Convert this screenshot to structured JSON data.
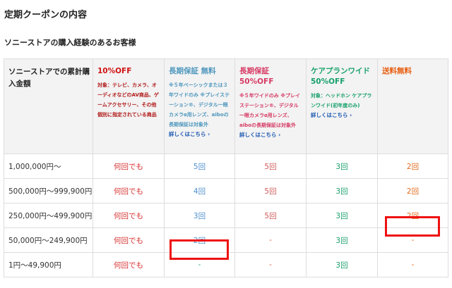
{
  "page": {
    "title": "定期クーポンの内容",
    "subtitle": "ソニーストアの購入経験のあるお客様"
  },
  "table": {
    "header_first": "ソニーストアでの累計購入金額",
    "columns": [
      {
        "title": "10%OFF",
        "note": "対象：テレビ、カメラ、オーディオなどのAV商品、ゲームアクセサリー、その他個別に指定されている商品",
        "link": ""
      },
      {
        "title": "長期保証 無料",
        "note": "※５年ベーシックまたは３年ワイドのみ ※プレイステーション®、デジタル一眼カメラα用レンズ、aiboの長期保証は対象外",
        "link": "詳しくはこちら ›"
      },
      {
        "title": "長期保証 50%OFF",
        "note": "※５年ワイドのみ ※プレイステーション®、デジタル一眼カメラα用レンズ、aiboの長期保証は対象外",
        "link": "詳しくはこちら ›"
      },
      {
        "title": "ケアプランワイド 50%OFF",
        "note": "対象：ヘッドホン ケアプランワイド(初年度のみ)",
        "link": "詳しくはこちら ›"
      },
      {
        "title": "送料無料",
        "note": "",
        "link": ""
      }
    ],
    "rows": [
      {
        "label": "1,000,000円〜",
        "cells": [
          "何回でも",
          "5回",
          "5回",
          "3回",
          "2回"
        ]
      },
      {
        "label": "500,000円〜999,900円",
        "cells": [
          "何回でも",
          "4回",
          "5回",
          "3回",
          "2回"
        ]
      },
      {
        "label": "250,000円〜499,900円",
        "cells": [
          "何回でも",
          "3回",
          "5回",
          "3回",
          "2回"
        ]
      },
      {
        "label": "50,000円〜249,900円",
        "cells": [
          "何回でも",
          "2回",
          "-",
          "3回",
          "-"
        ]
      },
      {
        "label": "1円〜49,900円",
        "cells": [
          "何回でも",
          "-",
          "-",
          "3回",
          "-"
        ]
      }
    ]
  },
  "colors": {
    "highlight_box": "#ee1111",
    "link": "#1a57b0",
    "header_bg": "#f3f3f3"
  }
}
